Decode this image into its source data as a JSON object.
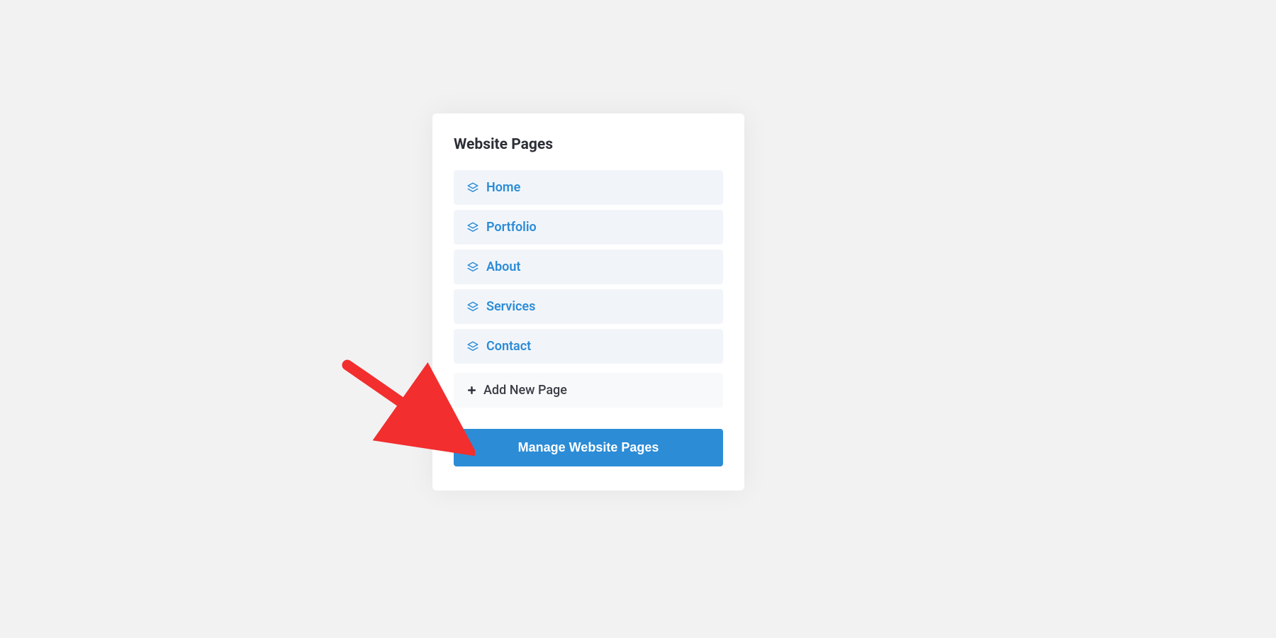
{
  "panel": {
    "title": "Website Pages",
    "pages": [
      {
        "label": "Home"
      },
      {
        "label": "Portfolio"
      },
      {
        "label": "About"
      },
      {
        "label": "Services"
      },
      {
        "label": "Contact"
      }
    ],
    "add_new_label": "Add New Page",
    "manage_button_label": "Manage Website Pages"
  },
  "colors": {
    "accent": "#2c8cd6",
    "page_bg": "#f1f5fa",
    "add_bg": "#f8f9fa",
    "annotation": "#f22e2e"
  }
}
